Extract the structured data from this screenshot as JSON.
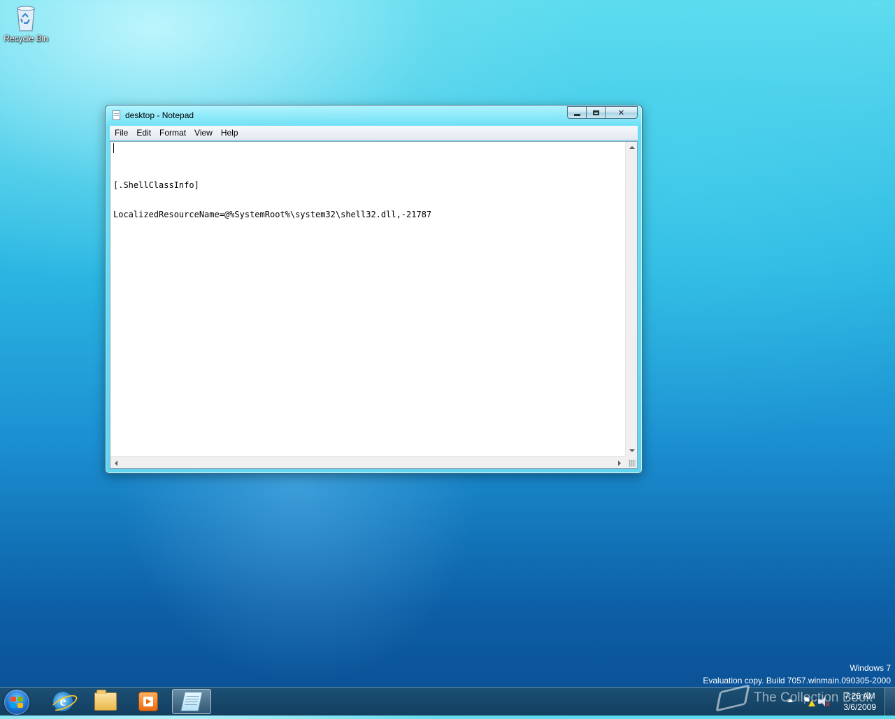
{
  "desktop": {
    "icons": [
      {
        "label": "Recycle Bin",
        "icon": "recycle-bin-icon"
      }
    ],
    "watermark": {
      "line1": "Windows 7",
      "line2": "Evaluation copy. Build 7057.winmain.090305-2000"
    },
    "overlay_watermark": "The Collection Book"
  },
  "window": {
    "title": "desktop - Notepad",
    "icon": "notepad-icon",
    "menu": [
      "File",
      "Edit",
      "Format",
      "View",
      "Help"
    ],
    "content": {
      "lines": [
        "[.ShellClassInfo]",
        "LocalizedResourceName=@%SystemRoot%\\system32\\shell32.dll,-21787"
      ]
    }
  },
  "taskbar": {
    "pinned": [
      {
        "name": "Internet Explorer",
        "icon": "internet-explorer-icon"
      },
      {
        "name": "Windows Explorer",
        "icon": "folder-icon"
      },
      {
        "name": "Windows Media Player",
        "icon": "media-player-icon"
      },
      {
        "name": "Notepad",
        "icon": "notepad-icon",
        "active": true
      }
    ],
    "clock": {
      "time": "7:26 AM",
      "date": "3/6/2009"
    }
  }
}
